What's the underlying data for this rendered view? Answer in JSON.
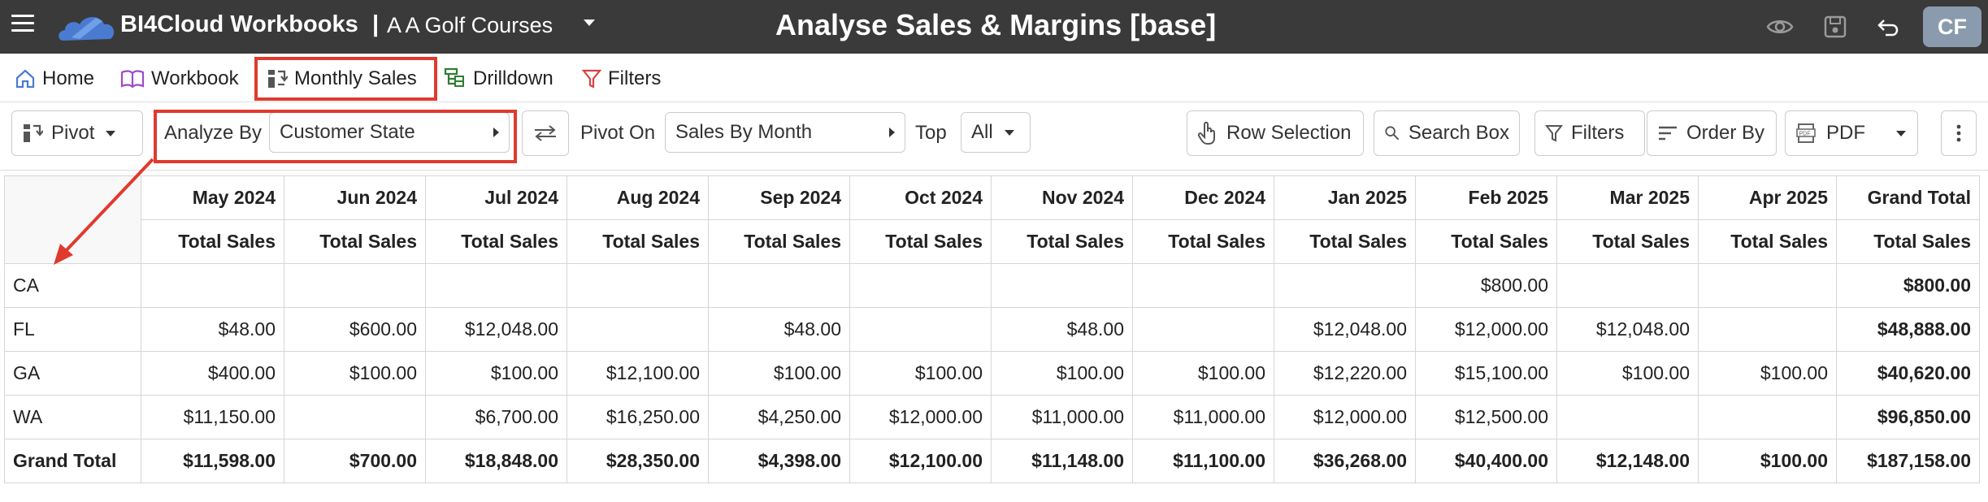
{
  "app": {
    "name": "BI4Cloud Workbooks",
    "separator": "|",
    "company": "A A Golf Courses",
    "page_title": "Analyse Sales & Margins [base]",
    "avatar": "CF"
  },
  "nav": {
    "items": [
      {
        "label": "Home",
        "icon": "home-icon"
      },
      {
        "label": "Workbook",
        "icon": "book-icon"
      },
      {
        "label": "Monthly Sales",
        "icon": "pivot-icon"
      },
      {
        "label": "Drilldown",
        "icon": "drilldown-icon"
      },
      {
        "label": "Filters",
        "icon": "filter-icon"
      }
    ]
  },
  "toolbar": {
    "pivot_label": "Pivot",
    "analyze_by_label": "Analyze By",
    "analyze_by_value": "Customer State",
    "pivot_on_label": "Pivot On",
    "pivot_on_value": "Sales By Month",
    "top_label": "Top",
    "top_value": "All",
    "row_selection_label": "Row Selection",
    "search_box_label": "Search Box",
    "filters_label": "Filters",
    "order_by_label": "Order By",
    "pdf_label": "PDF"
  },
  "table": {
    "months": [
      "May 2024",
      "Jun 2024",
      "Jul 2024",
      "Aug 2024",
      "Sep 2024",
      "Oct 2024",
      "Nov 2024",
      "Dec 2024",
      "Jan 2025",
      "Feb 2025",
      "Mar 2025",
      "Apr 2025",
      "Grand Total"
    ],
    "measure": "Total Sales",
    "rows": [
      {
        "label": "CA",
        "values": [
          "",
          "",
          "",
          "",
          "",
          "",
          "",
          "",
          "",
          "$800.00",
          "",
          "",
          "$800.00"
        ]
      },
      {
        "label": "FL",
        "values": [
          "$48.00",
          "$600.00",
          "$12,048.00",
          "",
          "$48.00",
          "",
          "$48.00",
          "",
          "$12,048.00",
          "$12,000.00",
          "$12,048.00",
          "",
          "$48,888.00"
        ]
      },
      {
        "label": "GA",
        "values": [
          "$400.00",
          "$100.00",
          "$100.00",
          "$12,100.00",
          "$100.00",
          "$100.00",
          "$100.00",
          "$100.00",
          "$12,220.00",
          "$15,100.00",
          "$100.00",
          "$100.00",
          "$40,620.00"
        ]
      },
      {
        "label": "WA",
        "values": [
          "$11,150.00",
          "",
          "$6,700.00",
          "$16,250.00",
          "$4,250.00",
          "$12,000.00",
          "$11,000.00",
          "$11,000.00",
          "$12,000.00",
          "$12,500.00",
          "",
          "",
          "$96,850.00"
        ]
      }
    ],
    "grand_total": {
      "label": "Grand Total",
      "values": [
        "$11,598.00",
        "$700.00",
        "$18,848.00",
        "$28,350.00",
        "$4,398.00",
        "$12,100.00",
        "$11,148.00",
        "$11,100.00",
        "$36,268.00",
        "$40,400.00",
        "$12,148.00",
        "$100.00",
        "$187,158.00"
      ]
    }
  },
  "colors": {
    "titlebar": "#3a3a3a",
    "highlight": "#e03a2e",
    "avatar": "#8a9bad"
  }
}
